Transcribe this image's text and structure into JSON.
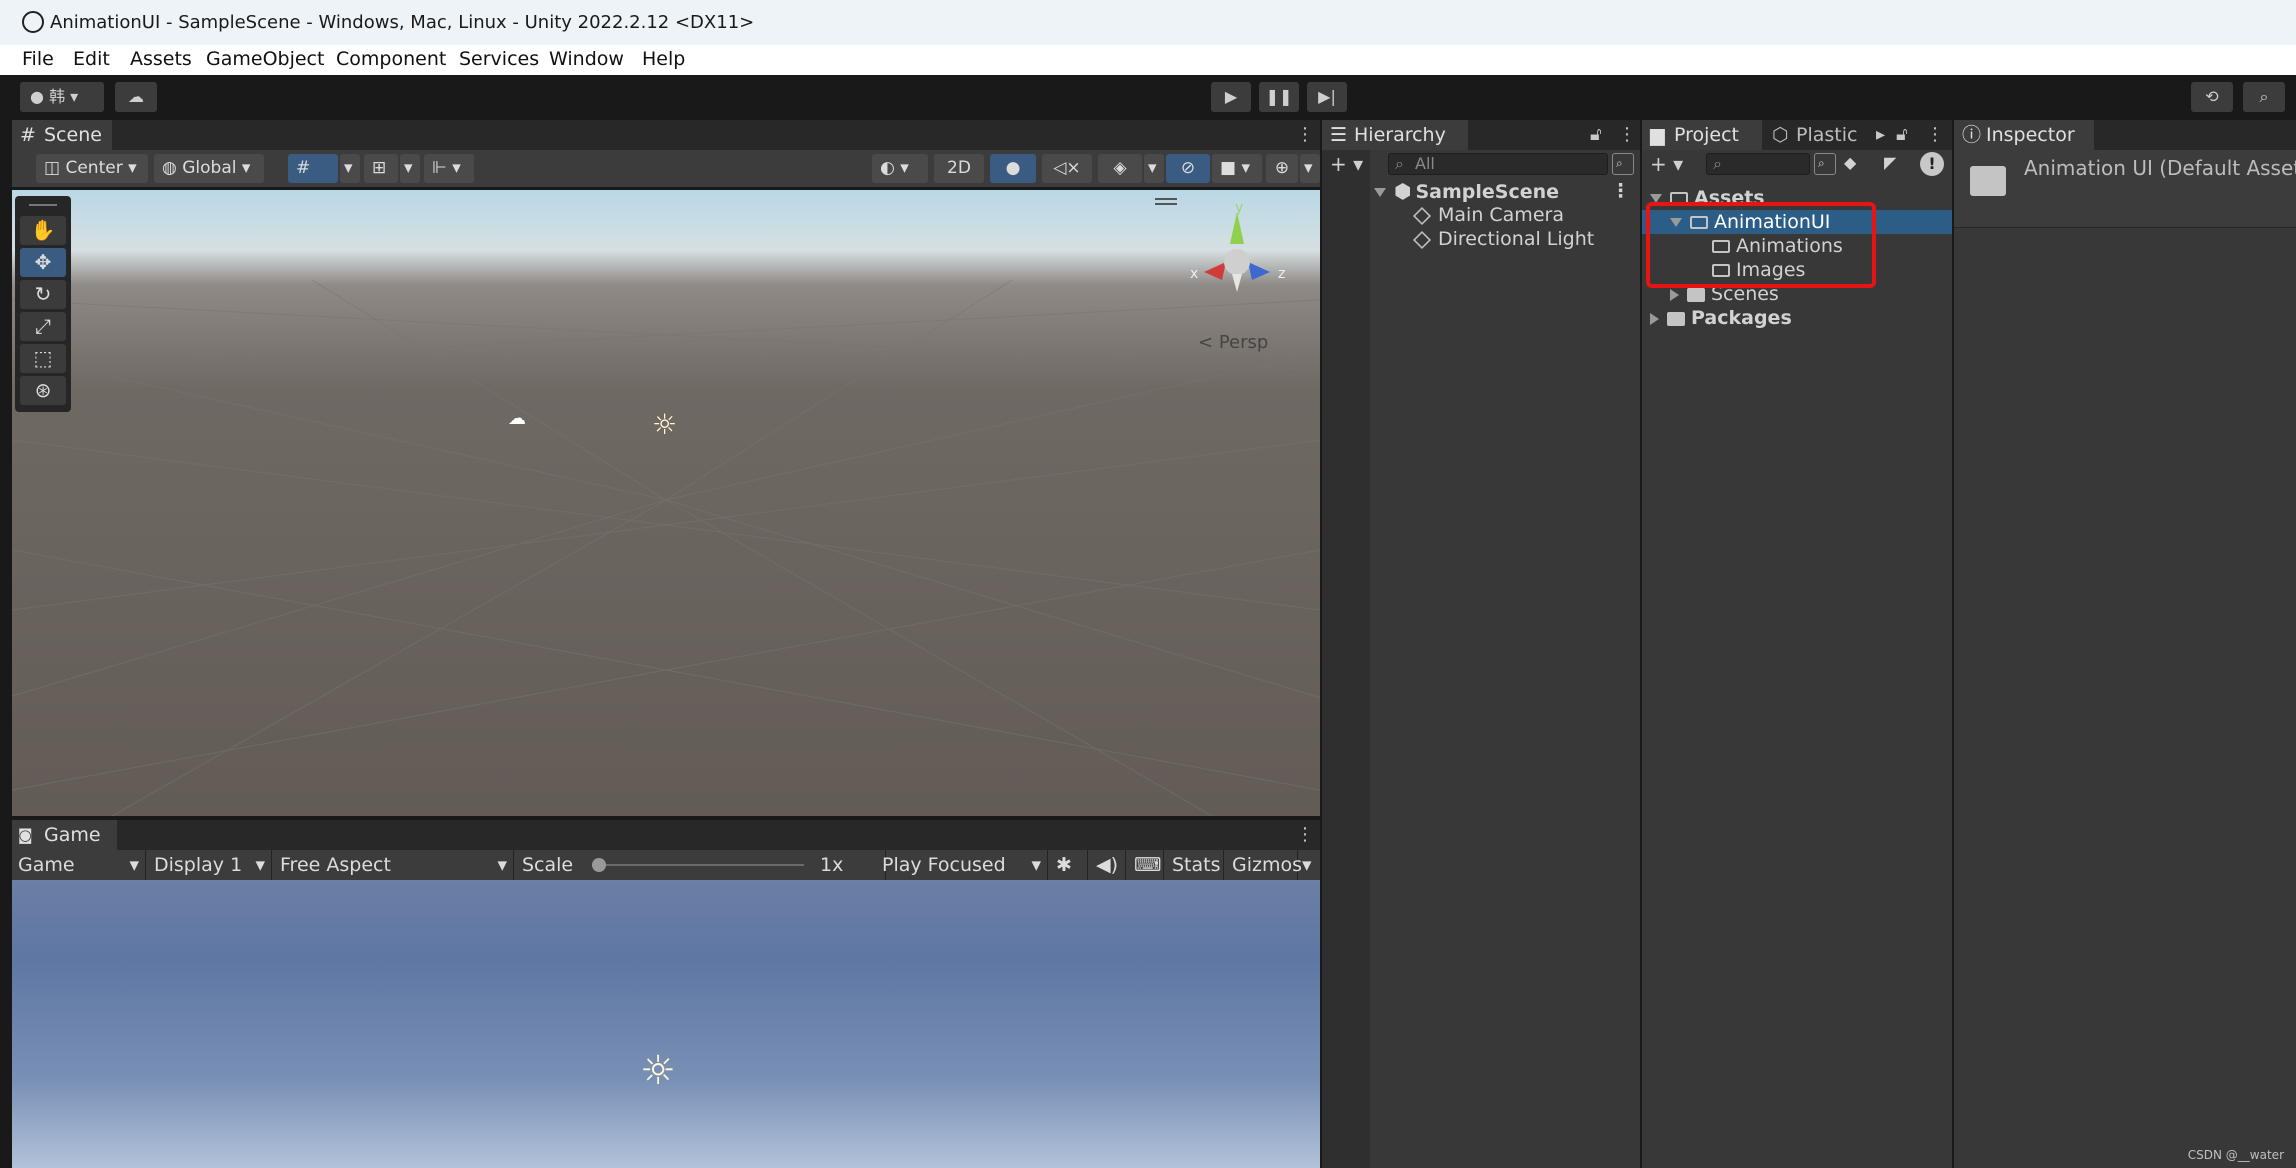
{
  "window": {
    "title": "AnimationUI - SampleScene - Windows, Mac, Linux - Unity 2022.2.12 <DX11>"
  },
  "menu": [
    "File",
    "Edit",
    "Assets",
    "GameObject",
    "Component",
    "Services",
    "Window",
    "Help"
  ],
  "toolbar": {
    "account_label": "韩"
  },
  "scene": {
    "tab_label": "Scene",
    "pivot_label": "Center",
    "space_label": "Global",
    "mode_2d_label": "2D",
    "projection_label": "Persp",
    "gizmo_axes": {
      "x": "x",
      "y": "y",
      "z": "z"
    }
  },
  "game": {
    "tab_label": "Game",
    "view_select": "Game",
    "display_select": "Display 1",
    "aspect_select": "Free Aspect",
    "scale_label": "Scale",
    "scale_value": "1x",
    "play_mode_select": "Play Focused",
    "stats_label": "Stats",
    "gizmos_label": "Gizmos"
  },
  "hierarchy": {
    "tab_label": "Hierarchy",
    "search_placeholder": "All",
    "scene_name": "SampleScene",
    "objects": [
      "Main Camera",
      "Directional Light"
    ]
  },
  "project": {
    "tab_label": "Project",
    "tab2_label": "Plastic",
    "assets_label": "Assets",
    "selected_folder": "AnimationUI",
    "subfolders": [
      "Animations",
      "Images"
    ],
    "scenes_label": "Scenes",
    "packages_label": "Packages"
  },
  "inspector": {
    "tab_label": "Inspector",
    "asset_title": "Animation UI (Default Asset)"
  },
  "credit": "CSDN @__water",
  "colors": {
    "selection": "#2c5d87",
    "highlight_box": "#e81414",
    "active_tool": "#3a5b82"
  }
}
